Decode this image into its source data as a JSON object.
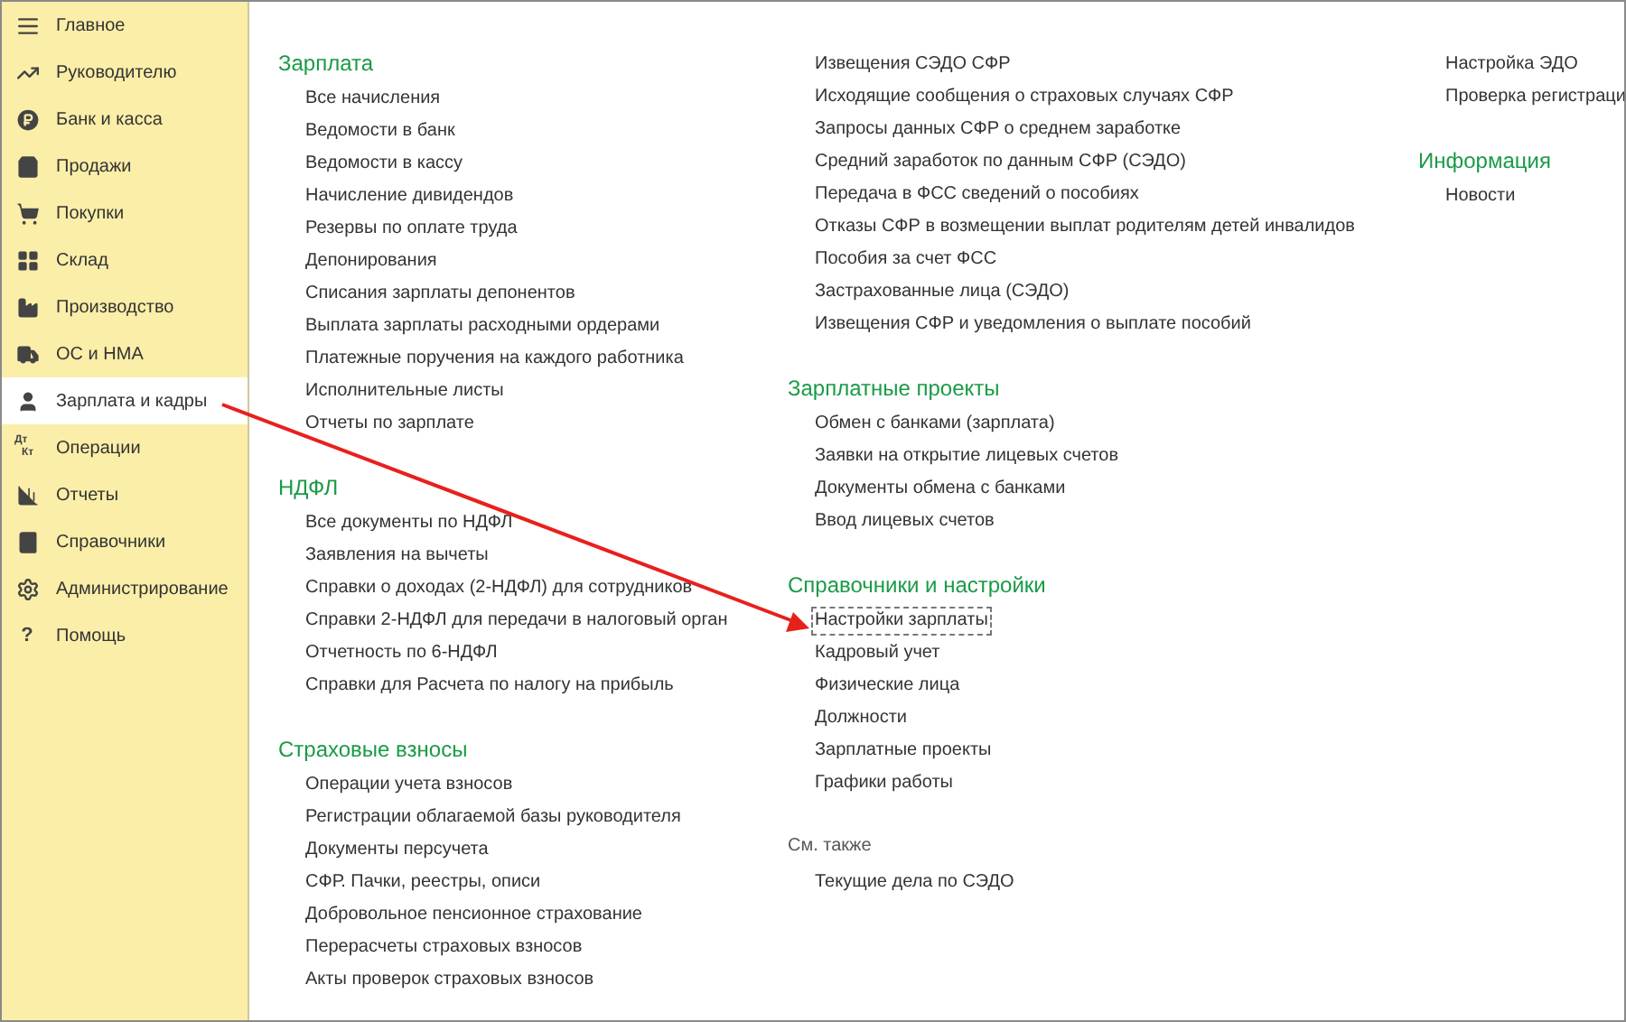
{
  "sidebar": {
    "items": [
      {
        "label": "Главное",
        "selected": false
      },
      {
        "label": "Руководителю",
        "selected": false
      },
      {
        "label": "Банк и касса",
        "selected": false
      },
      {
        "label": "Продажи",
        "selected": false
      },
      {
        "label": "Покупки",
        "selected": false
      },
      {
        "label": "Склад",
        "selected": false
      },
      {
        "label": "Производство",
        "selected": false
      },
      {
        "label": "ОС и НМА",
        "selected": false
      },
      {
        "label": "Зарплата и кадры",
        "selected": true
      },
      {
        "label": "Операции",
        "selected": false,
        "glyph": [
          "Дт",
          "Кт"
        ]
      },
      {
        "label": "Отчеты",
        "selected": false
      },
      {
        "label": "Справочники",
        "selected": false
      },
      {
        "label": "Администрирование",
        "selected": false
      },
      {
        "label": "Помощь",
        "selected": false,
        "glyph": [
          "?"
        ]
      }
    ]
  },
  "columns": [
    {
      "sections": [
        {
          "kind": "group",
          "title": "Зарплата",
          "items": [
            {
              "label": "Все начисления",
              "focused": false
            },
            {
              "label": "Ведомости в банк",
              "focused": false
            },
            {
              "label": "Ведомости в кассу",
              "focused": false
            },
            {
              "label": "Начисление дивидендов",
              "focused": false
            },
            {
              "label": "Резервы по оплате труда",
              "focused": false
            },
            {
              "label": "Депонирования",
              "focused": false
            },
            {
              "label": "Списания зарплаты депонентов",
              "focused": false
            },
            {
              "label": "Выплата зарплаты расходными ордерами",
              "focused": false
            },
            {
              "label": "Платежные поручения на каждого работника",
              "focused": false
            },
            {
              "label": "Исполнительные листы",
              "focused": false
            },
            {
              "label": "Отчеты по зарплате",
              "focused": false
            }
          ]
        },
        {
          "kind": "group",
          "title": "НДФЛ",
          "items": [
            {
              "label": "Все документы по НДФЛ",
              "focused": false
            },
            {
              "label": "Заявления на вычеты",
              "focused": false
            },
            {
              "label": "Справки о доходах (2-НДФЛ) для сотрудников",
              "focused": false
            },
            {
              "label": "Справки 2-НДФЛ для передачи в налоговый орган",
              "focused": false
            },
            {
              "label": "Отчетность по 6-НДФЛ",
              "focused": false
            },
            {
              "label": "Справки для Расчета по налогу на прибыль",
              "focused": false
            }
          ]
        },
        {
          "kind": "group",
          "title": "Страховые взносы",
          "items": [
            {
              "label": "Операции учета взносов",
              "focused": false
            },
            {
              "label": "Регистрации облагаемой базы руководителя",
              "focused": false
            },
            {
              "label": "Документы персучета",
              "focused": false
            },
            {
              "label": "СФР. Пачки, реестры, описи",
              "focused": false
            },
            {
              "label": "Добровольное пенсионное страхование",
              "focused": false
            },
            {
              "label": "Перерасчеты страховых взносов",
              "focused": false
            },
            {
              "label": "Акты проверок страховых взносов",
              "focused": false
            }
          ]
        }
      ]
    },
    {
      "sections": [
        {
          "kind": "continued",
          "items": [
            {
              "label": "Извещения СЭДО СФР",
              "focused": false
            },
            {
              "label": "Исходящие сообщения о страховых случаях СФР",
              "focused": false
            },
            {
              "label": "Запросы данных СФР о среднем заработке",
              "focused": false
            },
            {
              "label": "Средний заработок по данным СФР (СЭДО)",
              "focused": false
            },
            {
              "label": "Передача в ФСС сведений о пособиях",
              "focused": false
            },
            {
              "label": "Отказы СФР в возмещении выплат родителям детей инвалидов",
              "focused": false
            },
            {
              "label": "Пособия за счет ФСС",
              "focused": false
            },
            {
              "label": "Застрахованные лица (СЭДО)",
              "focused": false
            },
            {
              "label": "Извещения СФР и уведомления о выплате пособий",
              "focused": false
            }
          ]
        },
        {
          "kind": "group",
          "title": "Зарплатные проекты",
          "items": [
            {
              "label": "Обмен с банками (зарплата)",
              "focused": false
            },
            {
              "label": "Заявки на открытие лицевых счетов",
              "focused": false
            },
            {
              "label": "Документы обмена с банками",
              "focused": false
            },
            {
              "label": "Ввод лицевых счетов",
              "focused": false
            }
          ]
        },
        {
          "kind": "group",
          "title": "Справочники и настройки",
          "items": [
            {
              "label": "Настройки зарплаты",
              "focused": true
            },
            {
              "label": "Кадровый учет",
              "focused": false
            },
            {
              "label": "Физические лица",
              "focused": false
            },
            {
              "label": "Должности",
              "focused": false
            },
            {
              "label": "Зарплатные проекты",
              "focused": false
            },
            {
              "label": "Графики работы",
              "focused": false
            }
          ]
        },
        {
          "kind": "see_also",
          "title": "См. также",
          "items": [
            {
              "label": "Текущие дела по СЭДО",
              "focused": false
            }
          ]
        }
      ]
    },
    {
      "sections": [
        {
          "kind": "continued",
          "items": [
            {
              "label": "Настройка ЭДО",
              "focused": false
            },
            {
              "label": "Проверка регистраци",
              "focused": false
            }
          ]
        },
        {
          "kind": "group",
          "title": "Информация",
          "items": [
            {
              "label": "Новости",
              "focused": false
            }
          ]
        }
      ]
    }
  ]
}
